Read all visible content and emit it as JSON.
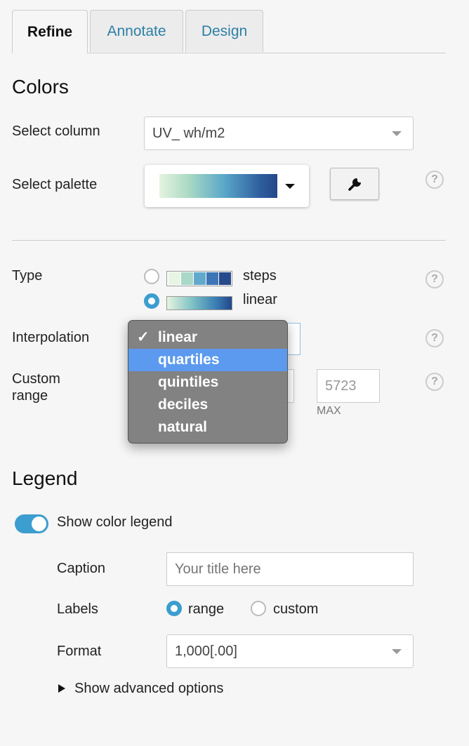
{
  "tabs": [
    {
      "label": "Refine",
      "active": true
    },
    {
      "label": "Annotate",
      "active": false
    },
    {
      "label": "Design",
      "active": false
    }
  ],
  "colors": {
    "heading": "Colors",
    "select_column_label": "Select column",
    "select_column_value": "UV_ wh/m2",
    "select_palette_label": "Select palette",
    "palette_gradient": [
      "#dcefd8",
      "#7cc0c4",
      "#3a7fb4",
      "#274a8d"
    ],
    "wrench_icon": "wrench-icon"
  },
  "type": {
    "label": "Type",
    "options": [
      {
        "label": "steps",
        "selected": false,
        "swatches": [
          "#e8f4e4",
          "#a9d8c8",
          "#63a9cd",
          "#3d76b6",
          "#274a8d"
        ]
      },
      {
        "label": "linear",
        "selected": true
      }
    ]
  },
  "interpolation": {
    "label": "Interpolation",
    "menu": [
      {
        "label": "linear",
        "checked": true,
        "highlighted": false
      },
      {
        "label": "quartiles",
        "checked": false,
        "highlighted": true
      },
      {
        "label": "quintiles",
        "checked": false,
        "highlighted": false
      },
      {
        "label": "deciles",
        "checked": false,
        "highlighted": false
      },
      {
        "label": "natural",
        "checked": false,
        "highlighted": false
      }
    ]
  },
  "custom_range": {
    "label_line1": "Custom",
    "label_line2": "range",
    "max_value": "5723",
    "max_label": "MAX"
  },
  "legend": {
    "heading": "Legend",
    "show_label": "Show color legend",
    "show_enabled": true,
    "caption_label": "Caption",
    "caption_placeholder": "Your title here",
    "labels_label": "Labels",
    "labels_options": [
      {
        "label": "range",
        "selected": true
      },
      {
        "label": "custom",
        "selected": false
      }
    ],
    "format_label": "Format",
    "format_value": "1,000[.00]",
    "advanced": "Show advanced options"
  },
  "accent_color": "#3c9dcf",
  "help_symbol": "?"
}
